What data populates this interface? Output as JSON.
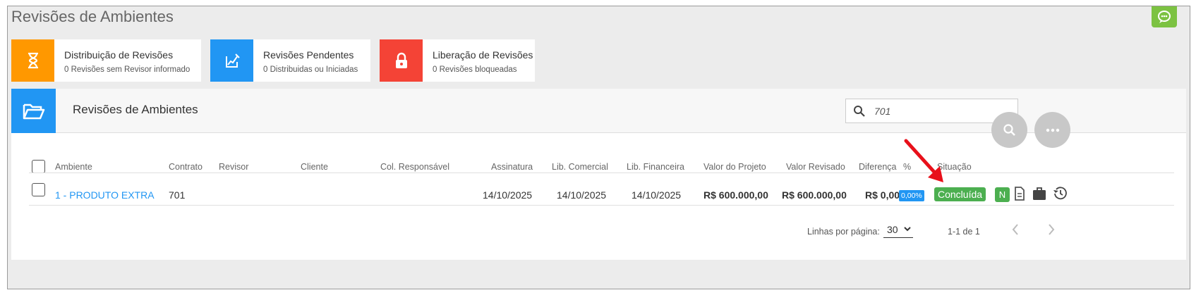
{
  "page": {
    "title": "Revisões de Ambientes"
  },
  "cards": [
    {
      "title": "Distribuição de Revisões",
      "subtitle": "0 Revisões sem Revisor informado",
      "color": "#ff9800",
      "icon": "hourglass-icon"
    },
    {
      "title": "Revisões Pendentes",
      "subtitle": "0 Distribuidas ou Iniciadas",
      "color": "#2196f3",
      "icon": "edit-chart-icon"
    },
    {
      "title": "Liberação de Revisões",
      "subtitle": "0 Revisões bloqueadas",
      "color": "#f44336",
      "icon": "lock-icon"
    }
  ],
  "panel": {
    "title": "Revisões de Ambientes",
    "search_value": "701"
  },
  "table": {
    "headers": {
      "ambiente": "Ambiente",
      "contrato": "Contrato",
      "revisor": "Revisor",
      "cliente": "Cliente",
      "col_responsavel": "Col. Responsável",
      "assinatura": "Assinatura",
      "lib_comercial": "Lib. Comercial",
      "lib_financeira": "Lib. Financeira",
      "valor_projeto": "Valor do Projeto",
      "valor_revisado": "Valor Revisado",
      "diferenca": "Diferença",
      "percent": "%",
      "situacao": "Situação"
    },
    "rows": [
      {
        "ambiente": "1 - PRODUTO EXTRA",
        "contrato": "701",
        "revisor": "",
        "cliente": "",
        "col_responsavel": "",
        "assinatura": "14/10/2025",
        "lib_comercial": "14/10/2025",
        "lib_financeira": "14/10/2025",
        "valor_projeto": "R$ 600.000,00",
        "valor_revisado": "R$ 600.000,00",
        "diferenca": "R$ 0,00",
        "percent": "0,00%",
        "situacao": "Concluída",
        "n_badge": "N"
      }
    ]
  },
  "pagination": {
    "rows_label": "Linhas por página:",
    "rows_per_page": "30",
    "range": "1-1 de 1"
  },
  "colors": {
    "accent_blue": "#2196f3",
    "status_green": "#4caf50",
    "annotation_red": "#e8101a"
  }
}
